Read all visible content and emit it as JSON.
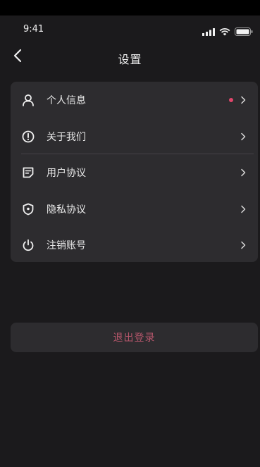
{
  "status_bar": {
    "time": "9:41"
  },
  "nav": {
    "title": "设置",
    "back_icon": "chevron-left-icon"
  },
  "menu": {
    "items": [
      {
        "label": "个人信息",
        "icon": "user-icon",
        "has_badge": true
      },
      {
        "label": "关于我们",
        "icon": "info-alert-icon",
        "has_badge": false
      },
      {
        "label": "用户协议",
        "icon": "document-icon",
        "has_badge": false
      },
      {
        "label": "隐私协议",
        "icon": "shield-icon",
        "has_badge": false
      },
      {
        "label": "注销账号",
        "icon": "power-icon",
        "has_badge": false
      }
    ]
  },
  "logout": {
    "label": "退出登录"
  },
  "colors": {
    "background": "#1b1a1c",
    "card": "#2d2c2f",
    "badge": "#e0466b",
    "logout_text": "#b5566b"
  }
}
